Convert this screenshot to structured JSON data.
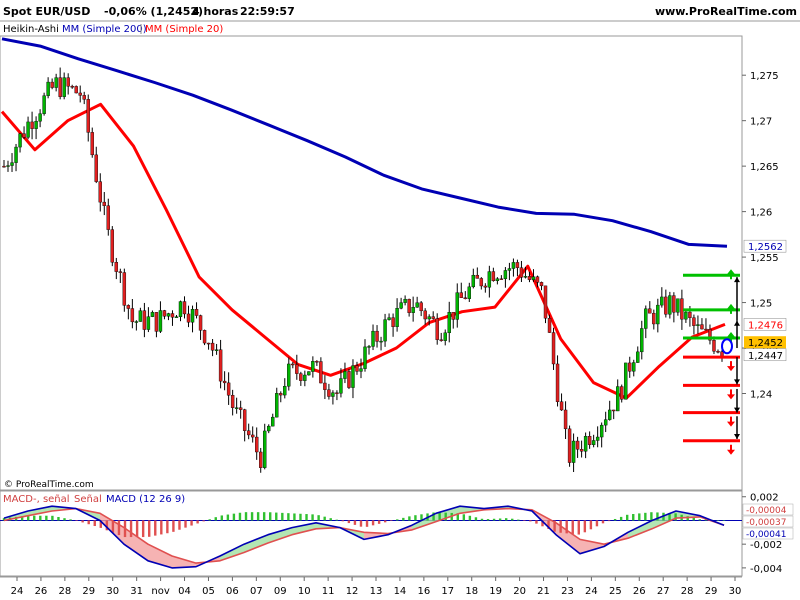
{
  "header": {
    "instrument": "Spot EUR/USD",
    "change": "-0,06% (1,2452)",
    "timeframe": "4 horas",
    "time": "22:59:57",
    "site": "www.ProRealTime.com"
  },
  "legend": {
    "chart_type": "Heikin-Ashi",
    "ma200": "MM (Simple 200)",
    "ma20": "MM (Simple 20)"
  },
  "copyright": "© ProRealTime.com",
  "macd_legend": {
    "macd_minus": "MACD-, señal",
    "signal": "Señal",
    "macd": "MACD (12 26 9)"
  },
  "colors": {
    "bull": "#00b400",
    "bear": "#e02020",
    "ma200": "#0000b4",
    "ma20": "#ff0000",
    "level_green": "#00c000",
    "level_red": "#ff0000",
    "price_tag": "#ffc000"
  },
  "chart_data": [
    {
      "type": "candlestick",
      "title": "Spot EUR/USD",
      "ylim": [
        1.2295,
        1.2792
      ],
      "x_ticks": [
        "24",
        "26",
        "28",
        "29",
        "30",
        "31",
        "nov",
        "04",
        "05",
        "06",
        "07",
        "09",
        "10",
        "11",
        "12",
        "13",
        "14",
        "16",
        "17",
        "18",
        "19",
        "20",
        "21",
        "23",
        "24",
        "25",
        "26",
        "27",
        "28",
        "29",
        "30"
      ],
      "y_ticks": [
        "1,275",
        "1,27",
        "1,265",
        "1,26",
        "1,255",
        "1,25",
        "1,245",
        "1,24"
      ],
      "y_tick_values": [
        1.275,
        1.27,
        1.265,
        1.26,
        1.255,
        1.25,
        1.245,
        1.24
      ],
      "price_labels": [
        {
          "text": "1,2562",
          "value": 1.2562
        },
        {
          "text": "1,2476",
          "value": 1.2476
        },
        {
          "text": "1,2452",
          "value": 1.2452
        },
        {
          "text": "1,2447",
          "value": 1.2447
        }
      ],
      "series": [
        {
          "name": "MM (Simple 200)",
          "values": [
            1.279,
            1.2782,
            1.2768,
            1.2755,
            1.2742,
            1.2728,
            1.2712,
            1.2695,
            1.2678,
            1.266,
            1.264,
            1.2625,
            1.2615,
            1.2605,
            1.2598,
            1.2597,
            1.259,
            1.2578,
            1.2564,
            1.2562
          ]
        },
        {
          "name": "MM (Simple 20)",
          "values": [
            1.271,
            1.2668,
            1.27,
            1.2718,
            1.2672,
            1.2602,
            1.2528,
            1.2492,
            1.2462,
            1.2432,
            1.242,
            1.2433,
            1.245,
            1.2478,
            1.249,
            1.2495,
            1.254,
            1.246,
            1.2412,
            1.2395,
            1.243,
            1.2462,
            1.2476
          ]
        }
      ],
      "levels": [
        {
          "value": 1.253,
          "color": "green"
        },
        {
          "value": 1.2492,
          "color": "green"
        },
        {
          "value": 1.2461,
          "color": "green"
        },
        {
          "value": 1.244,
          "color": "red"
        },
        {
          "value": 1.2409,
          "color": "red"
        },
        {
          "value": 1.2379,
          "color": "red"
        },
        {
          "value": 1.2348,
          "color": "red"
        }
      ]
    },
    {
      "type": "bar",
      "title": "MACD (12 26 9)",
      "ylim": [
        -0.0046,
        0.0024
      ],
      "y_ticks": [
        "0,002",
        "-0,002",
        "-0,004"
      ],
      "y_tick_values": [
        0.002,
        -0.002,
        -0.004
      ],
      "price_labels": [
        {
          "text": "-0,00004",
          "value": -4e-05
        },
        {
          "text": "-0,00037",
          "value": -0.00037
        },
        {
          "text": "-0,00041",
          "value": -0.00041
        }
      ],
      "series": [
        {
          "name": "MACD",
          "values": [
            0.0002,
            0.0008,
            0.0012,
            0.001,
            0.0,
            -0.002,
            -0.0034,
            -0.004,
            -0.0039,
            -0.003,
            -0.002,
            -0.0012,
            -0.0006,
            -0.0002,
            -0.0006,
            -0.0016,
            -0.0012,
            -0.0004,
            0.0006,
            0.0012,
            0.001,
            0.0012,
            0.0008,
            -0.0012,
            -0.0028,
            -0.0022,
            -0.001,
            0.0,
            0.0008,
            0.0004,
            -0.0004
          ]
        },
        {
          "name": "Señal",
          "values": [
            0.0,
            0.0004,
            0.0008,
            0.001,
            0.0006,
            -0.0006,
            -0.002,
            -0.003,
            -0.0036,
            -0.0034,
            -0.0027,
            -0.0019,
            -0.0012,
            -0.0007,
            -0.0006,
            -0.001,
            -0.0011,
            -0.0008,
            -0.0001,
            0.0006,
            0.0009,
            0.001,
            0.0009,
            -0.0002,
            -0.0016,
            -0.002,
            -0.0015,
            -0.0007,
            0.0002,
            0.0003,
            -0.0004
          ]
        },
        {
          "name": "MACD-, señal",
          "values": [
            0.0002,
            0.0004,
            0.0004,
            0.0,
            -0.0006,
            -0.0014,
            -0.0014,
            -0.001,
            -0.0003,
            0.0004,
            0.0007,
            0.0007,
            0.0006,
            0.0005,
            0.0,
            -0.0006,
            -0.0001,
            0.0004,
            0.0007,
            0.0006,
            0.0001,
            0.0002,
            -0.0001,
            -0.001,
            -0.0012,
            -0.0002,
            0.0005,
            0.0007,
            0.0006,
            0.0001,
            0.0
          ]
        }
      ]
    }
  ]
}
